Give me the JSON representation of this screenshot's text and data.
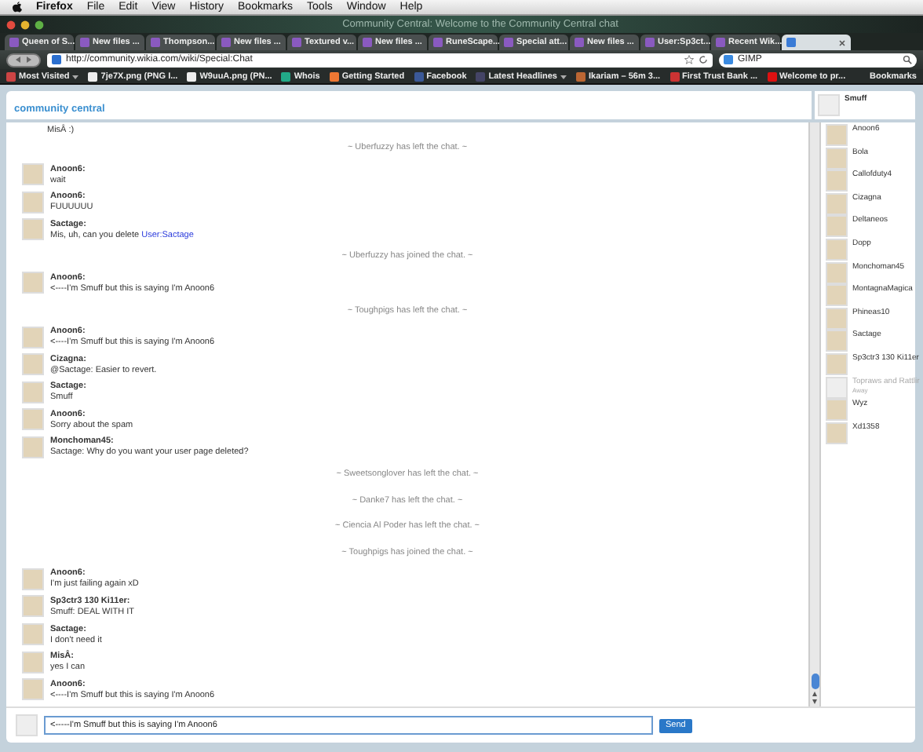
{
  "menubar": {
    "app": "Firefox",
    "items": [
      "File",
      "Edit",
      "View",
      "History",
      "Bookmarks",
      "Tools",
      "Window",
      "Help"
    ]
  },
  "window": {
    "title": "Community Central: Welcome to the Community Central chat"
  },
  "tabs": [
    {
      "label": "Queen of S...",
      "selected": false
    },
    {
      "label": "New files ...",
      "selected": false
    },
    {
      "label": "Thompson...",
      "selected": false
    },
    {
      "label": "New files ...",
      "selected": false
    },
    {
      "label": "Textured v...",
      "selected": false
    },
    {
      "label": "New files ...",
      "selected": false
    },
    {
      "label": "RuneScape...",
      "selected": false
    },
    {
      "label": "Special att...",
      "selected": false
    },
    {
      "label": "New files ...",
      "selected": false
    },
    {
      "label": "User:Sp3ct...",
      "selected": false
    },
    {
      "label": "Recent Wik...",
      "selected": false
    },
    {
      "selected": true
    }
  ],
  "navigation": {
    "url": "http://community.wikia.com/wiki/Special:Chat",
    "search": "GIMP"
  },
  "bookmarks": [
    {
      "label": "Most Visited",
      "menu": true
    },
    {
      "label": "7je7X.png (PNG I...",
      "menu": false
    },
    {
      "label": "W9uuA.png (PN...",
      "menu": false
    },
    {
      "label": "Whois",
      "menu": false
    },
    {
      "label": "Getting Started",
      "menu": false
    },
    {
      "label": "Facebook",
      "menu": false
    },
    {
      "label": "Latest Headlines",
      "menu": true
    },
    {
      "label": "Ikariam – 56m 3...",
      "menu": false
    },
    {
      "label": "First Trust Bank ...",
      "menu": false
    },
    {
      "label": "Welcome to pr...",
      "menu": false
    }
  ],
  "bookmarks_menu": "Bookmarks",
  "chat": {
    "logo": "community central",
    "current_user": "Smuff",
    "messages": [
      {
        "kind": "fragment",
        "text": "MisÂ :)"
      },
      {
        "kind": "system",
        "text": "~ Uberfuzzy has left the chat. ~"
      },
      {
        "kind": "message",
        "user": "Anoon6:",
        "text": "wait"
      },
      {
        "kind": "message",
        "user": "Anoon6:",
        "text": "FUUUUUU"
      },
      {
        "kind": "message",
        "user": "Sactage:",
        "text": "Mis, uh, can you delete",
        "link": "User:Sactage"
      },
      {
        "kind": "system",
        "text": "~ Uberfuzzy has joined the chat. ~"
      },
      {
        "kind": "message",
        "user": "Anoon6:",
        "text": "<----I'm Smuff but this is saying I'm Anoon6"
      },
      {
        "kind": "system",
        "text": "~ Toughpigs has left the chat. ~"
      },
      {
        "kind": "message",
        "user": "Anoon6:",
        "text": "<----I'm Smuff but this is saying I'm Anoon6"
      },
      {
        "kind": "message",
        "user": "Cizagna:",
        "text": "@Sactage: Easier to revert."
      },
      {
        "kind": "message",
        "user": "Sactage:",
        "text": "Smuff"
      },
      {
        "kind": "message",
        "user": "Anoon6:",
        "text": "Sorry about the spam"
      },
      {
        "kind": "message",
        "user": "Monchoman45:",
        "text": "Sactage: Why do you want your user page deleted?"
      },
      {
        "kind": "system",
        "text": "~ Sweetsonglover has left the chat. ~"
      },
      {
        "kind": "system",
        "text": "~ Danke7 has left the chat. ~"
      },
      {
        "kind": "system",
        "text": "~ Ciencia Al Poder has left the chat. ~"
      },
      {
        "kind": "system",
        "text": "~ Toughpigs has joined the chat. ~"
      },
      {
        "kind": "message",
        "user": "Anoon6:",
        "text": "I'm just failing again xD"
      },
      {
        "kind": "message",
        "user": "Sp3ctr3 130 Ki11er:",
        "text": "Smuff: DEAL WITH IT"
      },
      {
        "kind": "message",
        "user": "Sactage:",
        "text": "I don't need it"
      },
      {
        "kind": "message",
        "user": "MisÂ:",
        "text": "yes I can"
      },
      {
        "kind": "message",
        "user": "Anoon6:",
        "text": "<----I'm Smuff but this is saying I'm Anoon6"
      }
    ],
    "input": {
      "value": "<-----I'm Smuff but this is saying I'm Anoon6"
    },
    "send_button": "Send"
  },
  "users": [
    {
      "name": "Anoon6",
      "away": false
    },
    {
      "name": "Bola",
      "away": false
    },
    {
      "name": "Callofduty4",
      "away": false
    },
    {
      "name": "Cizagna",
      "away": false
    },
    {
      "name": "Deltaneos",
      "away": false
    },
    {
      "name": "Dopp",
      "away": false
    },
    {
      "name": "Monchoman45",
      "away": false
    },
    {
      "name": "MontagnaMagica",
      "away": false
    },
    {
      "name": "Phineas10",
      "away": false
    },
    {
      "name": "Sactage",
      "away": false
    },
    {
      "name": "Sp3ctr3 130 Ki11er",
      "away": false
    },
    {
      "name": "Topraws and Rattlir",
      "away": true,
      "status": "Away"
    },
    {
      "name": "Wyz",
      "away": false
    },
    {
      "name": "Xd1358",
      "away": false
    }
  ]
}
